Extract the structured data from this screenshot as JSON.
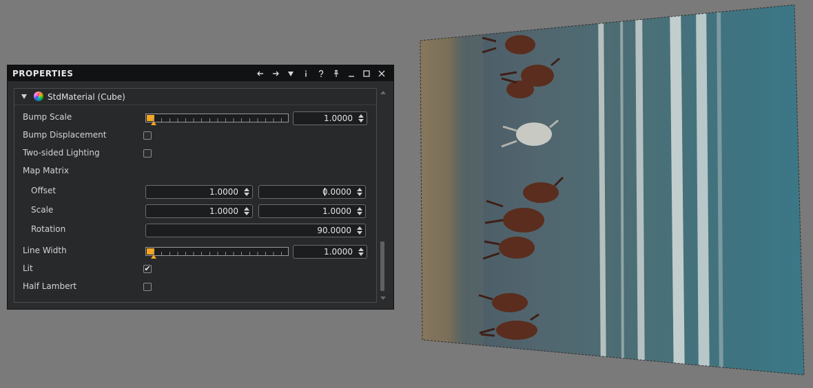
{
  "panel": {
    "title": "PROPERTIES",
    "toolbar_icons": [
      "back-arrow-icon",
      "forward-arrow-icon",
      "dropdown-icon",
      "info-icon",
      "help-icon",
      "pin-icon",
      "minimize-icon",
      "maximize-icon",
      "close-icon"
    ],
    "toolbar_glyphs": {
      "back": "←",
      "forward": "→",
      "dropdown": "▼",
      "info": "i",
      "help": "?",
      "pin": "⨼",
      "minimize": "_",
      "maximize": "□",
      "close": "✕"
    }
  },
  "section": {
    "title": "StdMaterial (Cube)",
    "expanded": true
  },
  "properties": {
    "bump_scale": {
      "label": "Bump Scale",
      "value": "1.0000",
      "slider_fraction": 0.03
    },
    "bump_displacement": {
      "label": "Bump Displacement",
      "checked": false
    },
    "two_sided_lighting": {
      "label": "Two-sided Lighting",
      "checked": false
    },
    "map_matrix": {
      "label": "Map Matrix",
      "offset": {
        "label": "Offset",
        "x": "1.0000",
        "y": "0.0000"
      },
      "scale": {
        "label": "Scale",
        "x": "1.0000",
        "y": "1.0000"
      },
      "rotation": {
        "label": "Rotation",
        "value": "90.0000"
      }
    },
    "line_width": {
      "label": "Line Width",
      "value": "1.0000",
      "slider_fraction": 0.03
    },
    "lit": {
      "label": "Lit",
      "checked": true,
      "check_glyph": "✔"
    },
    "half_lambert": {
      "label": "Half Lambert",
      "checked": false
    }
  },
  "colors": {
    "accent": "#f5a623",
    "panel_bg": "#2a2c2e",
    "titlebar_bg": "#111214",
    "viewport_bg": "#7a7a7a"
  },
  "viewport": {
    "content": "rotated texture of horses running along a beach, mapped on a perspective plane"
  }
}
